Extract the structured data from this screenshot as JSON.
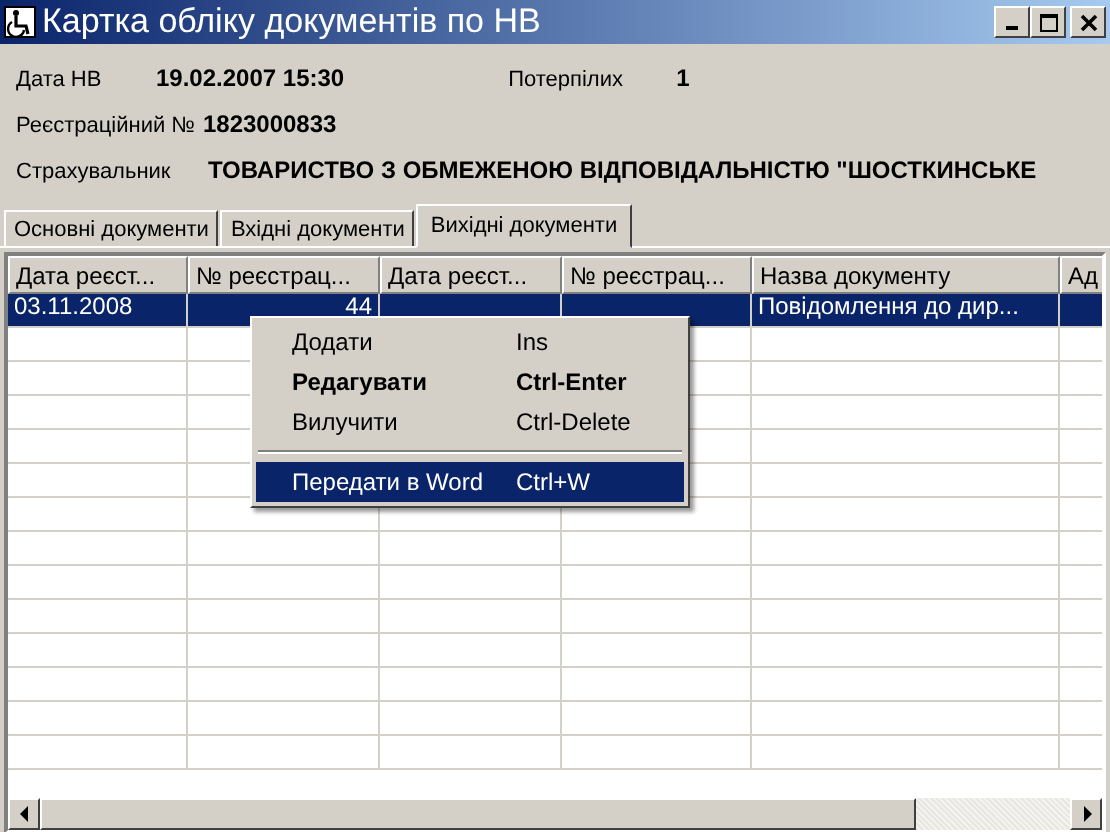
{
  "window": {
    "title": "Картка обліку документів по НВ"
  },
  "info_rows": [
    [
      {
        "label": "Дата НВ",
        "value": "19.02.2007 15:30"
      },
      {
        "label": "Потерпілих",
        "value": "1"
      }
    ],
    [
      {
        "label": "Реєстраційний №",
        "value": "1823000833"
      }
    ],
    [
      {
        "label": "Страхувальник",
        "value": "ТОВАРИСТВО З ОБМЕЖЕНОЮ ВІДПОВІДАЛЬНІСТЮ \"ШОСТКИНСЬКЕ"
      }
    ]
  ],
  "tabs": [
    {
      "label": "Основні документи",
      "selected": false
    },
    {
      "label": "Вхідні документи",
      "selected": false
    },
    {
      "label": "Вихідні документи",
      "selected": true
    }
  ],
  "table": {
    "columns": [
      "Дата реєст...",
      "№ реєстрац...",
      "Дата реєст...",
      "№ реєстрац...",
      "Назва документу",
      "Ад"
    ],
    "rows": [
      {
        "selected": true,
        "cells": [
          "03.11.2008",
          "44",
          "",
          "",
          "Повідомлення до дир...",
          ""
        ]
      }
    ]
  },
  "context_menu": [
    {
      "kind": "item",
      "label": "Додати",
      "shortcut": "Ins",
      "default": false,
      "selected": false
    },
    {
      "kind": "item",
      "label": "Редагувати",
      "shortcut": "Ctrl-Enter",
      "default": true,
      "selected": false
    },
    {
      "kind": "item",
      "label": "Вилучити",
      "shortcut": "Ctrl-Delete",
      "default": false,
      "selected": false
    },
    {
      "kind": "separator"
    },
    {
      "kind": "item",
      "label": "Передати в Word",
      "shortcut": "Ctrl+W",
      "default": false,
      "selected": true
    }
  ]
}
